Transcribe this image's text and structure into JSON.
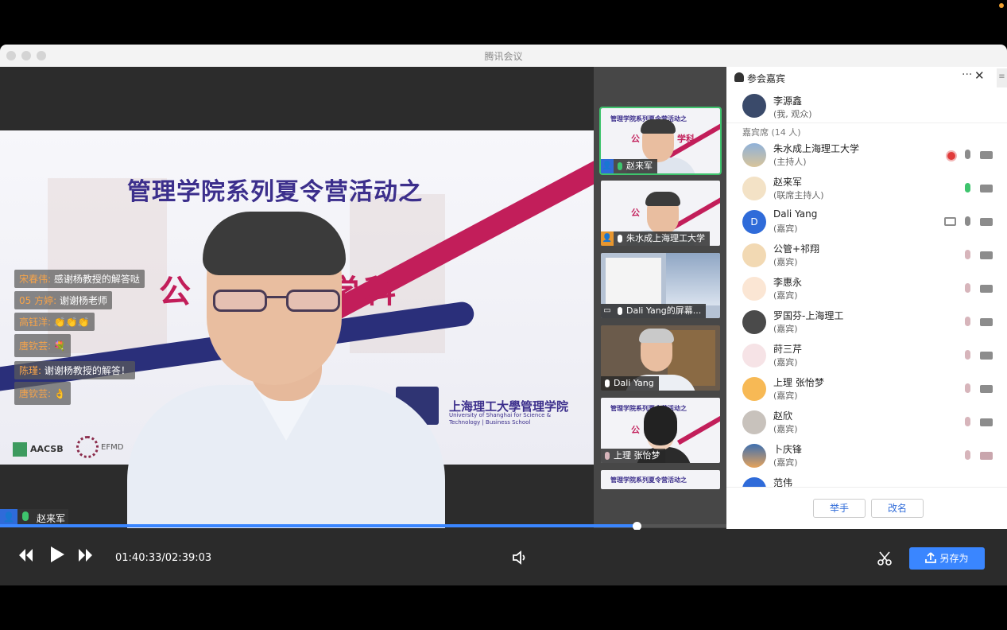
{
  "window": {
    "title": "腾讯会议"
  },
  "slide": {
    "title": "管理学院系列夏令营活动之",
    "subtitle_left": "公",
    "subtitle_right": "学科",
    "school_cn": "上海理工大學管理学院",
    "school_en": "University of Shanghai for Science & Technology | Business School",
    "aacsb": "AACSB",
    "efmd": "EFMD"
  },
  "chat": [
    {
      "who": "宋春伟:",
      "text": " 感谢杨教授的解答哒"
    },
    {
      "who": "05 方婷:",
      "text": " 谢谢杨老师"
    },
    {
      "who": "高钰洋:",
      "text": " 👏👏👏"
    },
    {
      "who": "唐钦芸:",
      "text": " 💐"
    },
    {
      "who": "陈瑾:",
      "text": " 谢谢杨教授的解答！"
    },
    {
      "who": "唐钦芸:",
      "text": " 👌"
    }
  ],
  "main_speaker": {
    "name": "赵来军"
  },
  "tiles": [
    {
      "name": "赵来军",
      "slide_title": "管理学院系列夏令营活动之",
      "frag": "公",
      "frag2": "学科"
    },
    {
      "name": "朱水成上海理工大学",
      "frag": "公"
    },
    {
      "name": "Dali Yang的屏幕..."
    },
    {
      "name": "Dali Yang"
    },
    {
      "name": "上理 张怡梦",
      "slide_title": "管理学院系列夏令营活动之",
      "frag": "公"
    },
    {
      "slide_title": "管理学院系列夏令营活动之"
    }
  ],
  "panel": {
    "title": "参会嘉宾",
    "more": "···",
    "close": "✕",
    "me": {
      "name": "李源鑫",
      "role": "(我, 观众)"
    },
    "section": "嘉宾席 (14 人)",
    "participants": [
      {
        "name": "朱水成上海理工大学",
        "role": "(主持人)"
      },
      {
        "name": "赵来军",
        "role": "(联席主持人)"
      },
      {
        "name": "Dali Yang",
        "role": "(嘉宾)",
        "avatar_letter": "D"
      },
      {
        "name": "公管+祁翔",
        "role": "(嘉宾)"
      },
      {
        "name": "李惠永",
        "role": "(嘉宾)"
      },
      {
        "name": "罗国芬-上海理工",
        "role": "(嘉宾)"
      },
      {
        "name": "莳三芹",
        "role": "(嘉宾)"
      },
      {
        "name": "上理 张怡梦",
        "role": "(嘉宾)"
      },
      {
        "name": "赵欣",
        "role": "(嘉宾)"
      },
      {
        "name": "卜庆锋",
        "role": "(嘉宾)"
      },
      {
        "name": "范伟",
        "role": ""
      }
    ],
    "buttons": {
      "raise_hand": "举手",
      "rename": "改名"
    }
  },
  "player": {
    "time": "01:40:33/02:39:03",
    "progress": 0.876,
    "save_label": "另存为"
  },
  "icons": {
    "rewind": "rewind-icon",
    "play": "play-icon",
    "forward": "forward-icon",
    "volume": "volume-icon",
    "scissors": "scissors-icon",
    "upload": "upload-icon"
  },
  "colors": {
    "accent": "#3a86ff",
    "active_green": "#3ec46d",
    "slide_magenta": "#c21e5a",
    "slide_navy": "#2a2f7a"
  }
}
